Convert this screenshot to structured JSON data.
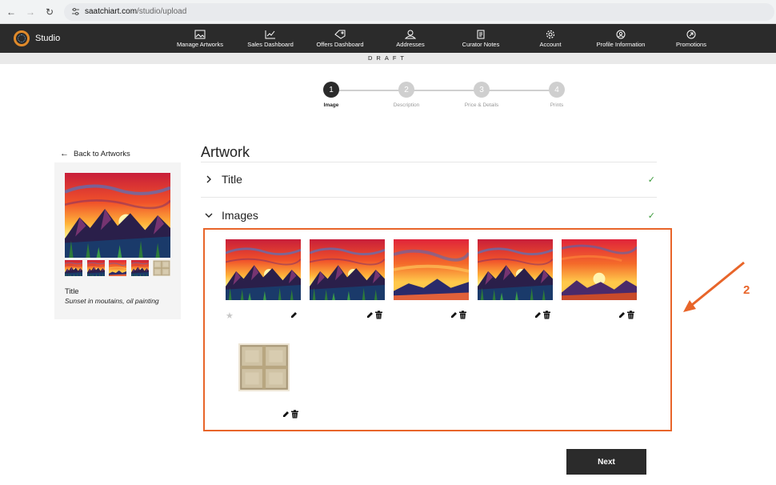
{
  "browser": {
    "url_host": "saatchiart.com",
    "url_path": "/studio/upload"
  },
  "brand": {
    "name": "Studio"
  },
  "nav": {
    "items": [
      {
        "label": "Manage Artworks",
        "icon": "image-icon"
      },
      {
        "label": "Sales Dashboard",
        "icon": "chart-icon"
      },
      {
        "label": "Offers Dashboard",
        "icon": "tag-icon"
      },
      {
        "label": "Addresses",
        "icon": "user-location-icon"
      },
      {
        "label": "Curator Notes",
        "icon": "notes-icon"
      },
      {
        "label": "Account",
        "icon": "gear-icon"
      },
      {
        "label": "Profile Information",
        "icon": "profile-icon"
      },
      {
        "label": "Promotions",
        "icon": "promotion-icon"
      }
    ]
  },
  "status_banner": "DRAFT",
  "stepper": {
    "steps": [
      {
        "number": "1",
        "label": "Image",
        "active": true
      },
      {
        "number": "2",
        "label": "Description",
        "active": false
      },
      {
        "number": "3",
        "label": "Price & Details",
        "active": false
      },
      {
        "number": "4",
        "label": "Prints",
        "active": false
      }
    ]
  },
  "sidebar": {
    "back_label": "Back to Artworks",
    "title_label": "Title",
    "artwork_description": "Sunset in moutains, oil painting"
  },
  "main": {
    "heading": "Artwork",
    "sections": [
      {
        "label": "Title",
        "expanded": false,
        "complete": true
      },
      {
        "label": "Images",
        "expanded": true,
        "complete": true
      }
    ]
  },
  "annotation": {
    "number": "2",
    "color": "#e8652a"
  },
  "next_button": "Next",
  "colors": {
    "accent": "#e8652a",
    "nav_bg": "#2b2b2b",
    "check": "#3a9a3a"
  }
}
